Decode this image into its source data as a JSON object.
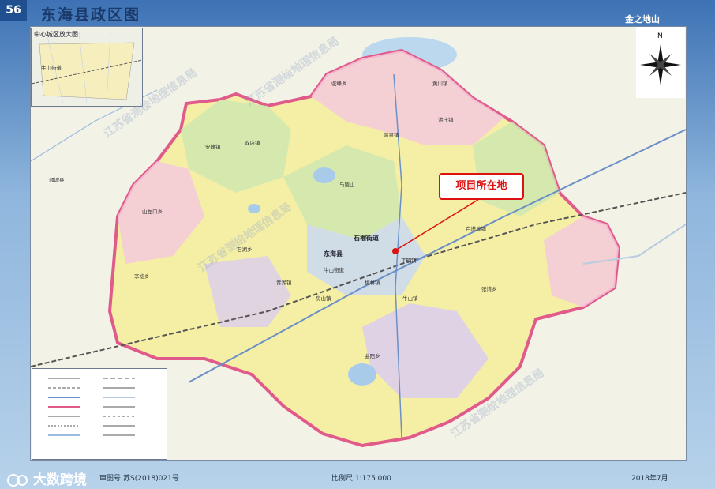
{
  "page_number": "56",
  "title": "东海县政区图",
  "inset": {
    "title": "中心城区放大图",
    "labels": [
      "牛山街道"
    ]
  },
  "callout": "项目所在地",
  "brand": "大数跨境",
  "footer": {
    "review_no": "审图号:苏S(2018)021号",
    "scale": "比例尺 1:175 000",
    "date": "2018年7月"
  },
  "corner_text": "金之地山",
  "main_labels": [
    "东海县",
    "石榴街道",
    "牛山街道",
    "黄川镇",
    "驼峰乡",
    "山左口乡",
    "安峰镇",
    "双店镇",
    "温泉镇",
    "李埝乡",
    "青湖镇",
    "石湖乡",
    "曲阳乡",
    "张湾乡",
    "平明镇",
    "白塔埠镇",
    "洪庄镇",
    "桃林镇",
    "牛山镇",
    "房山镇",
    "郯城县",
    "马陵山"
  ],
  "watermarks": [
    "江苏省测绘地理信息局",
    "江苏省测绘地理信息局",
    "江苏省测绘地理信息局",
    "江苏省测绘地理信息局"
  ],
  "colors": {
    "boundary": "#e05a8a",
    "pink": "#f3c9dc",
    "yellow": "#f5efa6",
    "green": "#cfe8b0",
    "blue": "#c9d9f2",
    "violet": "#d9cdef",
    "callout": "#dd1111"
  }
}
